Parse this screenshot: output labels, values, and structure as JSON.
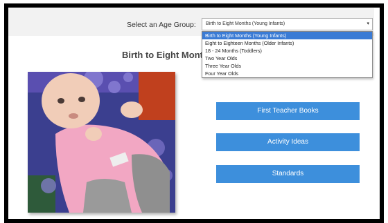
{
  "age_selector": {
    "label": "Select an Age Group:",
    "selected": "Birth to Eight Months (Young Infants)",
    "options": [
      "Birth to Eight Months (Young Infants)",
      "Eight to Eighteen Months (Older Infants)",
      "18 - 24 Months (Toddlers)",
      "Two Year Olds",
      "Three Year Olds",
      "Four Year Olds"
    ]
  },
  "page": {
    "title": "Birth to Eight Mont"
  },
  "buttons": {
    "first_teacher_books": "First Teacher Books",
    "activity_ideas": "Activity Ideas",
    "standards": "Standards"
  },
  "colors": {
    "button": "#3d8fdc",
    "dropdown_highlight": "#3a7bd5"
  }
}
